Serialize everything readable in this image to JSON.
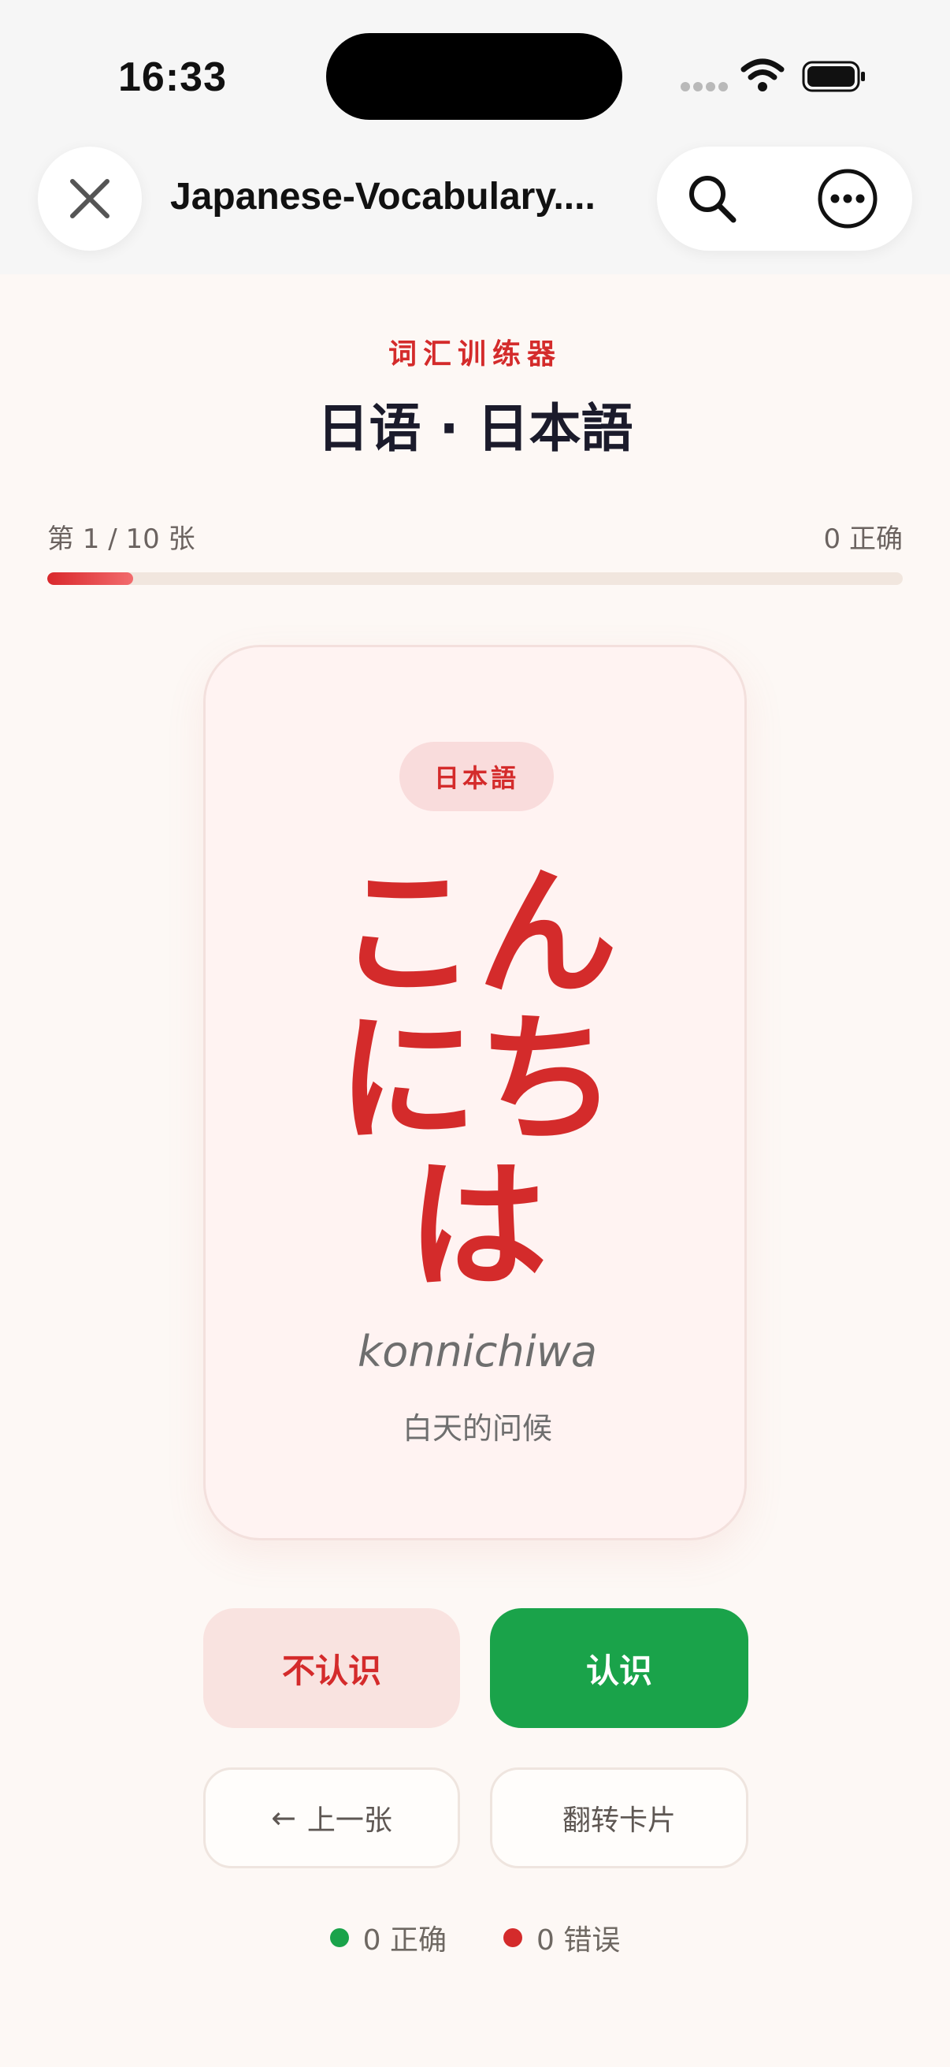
{
  "status_bar": {
    "time": "16:33"
  },
  "browser": {
    "title": "Japanese-Vocabulary....",
    "icons": [
      "close-icon",
      "search-icon",
      "more-icon"
    ]
  },
  "header": {
    "eyebrow": "词汇训练器",
    "title": "日语 · 日本語"
  },
  "progress": {
    "label": "第 1 / 10 张",
    "score": "0 正确",
    "fraction": 0.1
  },
  "card": {
    "lang_tag": "日本語",
    "word": "こんにちは",
    "romaji": "konnichiwa",
    "meaning": "白天的问候"
  },
  "actions": {
    "unknown_label": "不认识",
    "known_label": "认识",
    "prev_label": "上一张",
    "prev_arrow": "←",
    "flip_label": "翻转卡片"
  },
  "stats": {
    "correct": "0 正确",
    "wrong": "0 错误"
  },
  "colors": {
    "accent": "#d42b2b",
    "success": "#1aa34a",
    "background": "#fdf8f5"
  }
}
